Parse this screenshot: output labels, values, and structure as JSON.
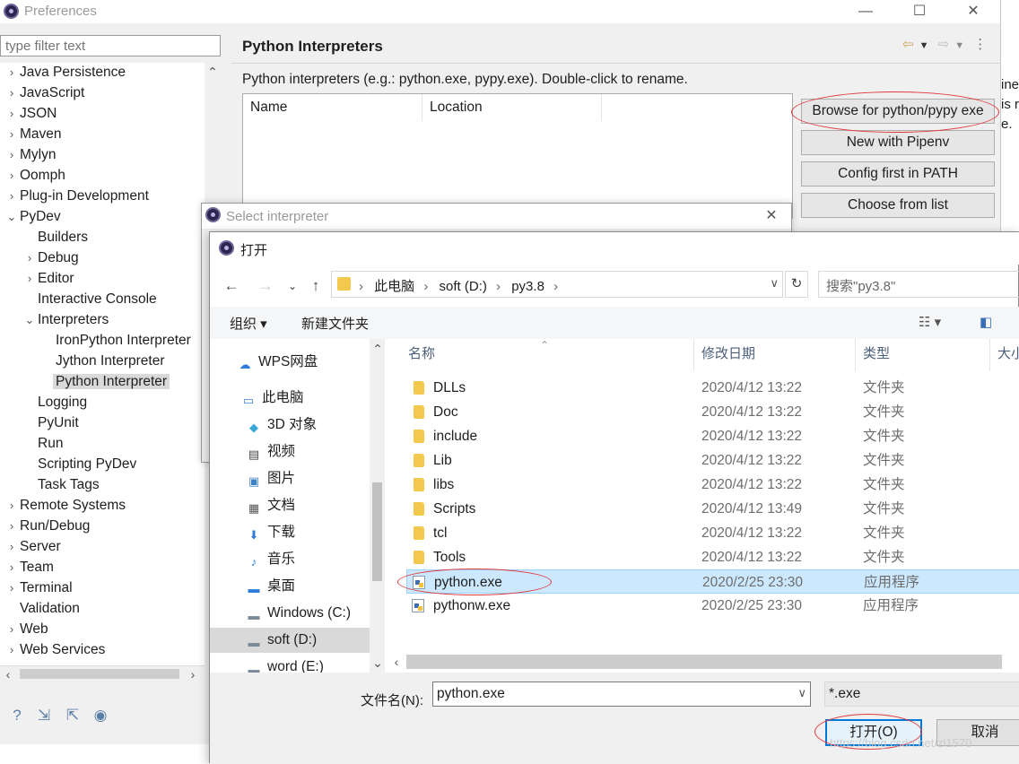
{
  "preferences": {
    "title": "Preferences",
    "filter_placeholder": "type filter text",
    "tree": [
      {
        "label": "Java Persistence",
        "expanded": false
      },
      {
        "label": "JavaScript",
        "expanded": false
      },
      {
        "label": "JSON",
        "expanded": false
      },
      {
        "label": "Maven",
        "expanded": false
      },
      {
        "label": "Mylyn",
        "expanded": false
      },
      {
        "label": "Oomph",
        "expanded": false
      },
      {
        "label": "Plug-in Development",
        "expanded": false
      },
      {
        "label": "PyDev",
        "expanded": true
      },
      {
        "label": "Builders"
      },
      {
        "label": "Debug",
        "expanded": false
      },
      {
        "label": "Editor",
        "expanded": false
      },
      {
        "label": "Interactive Console"
      },
      {
        "label": "Interpreters",
        "expanded": true
      },
      {
        "label": "IronPython Interpreter"
      },
      {
        "label": "Jython Interpreter"
      },
      {
        "label": "Python Interpreter",
        "selected": true
      },
      {
        "label": "Logging"
      },
      {
        "label": "PyUnit"
      },
      {
        "label": "Run"
      },
      {
        "label": "Scripting PyDev"
      },
      {
        "label": "Task Tags"
      },
      {
        "label": "Remote Systems",
        "expanded": false
      },
      {
        "label": "Run/Debug",
        "expanded": false
      },
      {
        "label": "Server",
        "expanded": false
      },
      {
        "label": "Team",
        "expanded": false
      },
      {
        "label": "Terminal",
        "expanded": false
      },
      {
        "label": "Validation"
      },
      {
        "label": "Web",
        "expanded": false
      },
      {
        "label": "Web Services",
        "expanded": false
      }
    ],
    "page_title": "Python Interpreters",
    "description": "Python interpreters (e.g.: python.exe, pypy.exe).   Double-click to rename.",
    "table_headers": [
      "Name",
      "Location"
    ],
    "buttons": {
      "browse": "Browse for python/pypy exe",
      "pipenv": "New with Pipenv",
      "config_path": "Config first in PATH",
      "choose_list": "Choose from list"
    },
    "bg_text": "ine\nis r\ne."
  },
  "select_interpreter": {
    "title": "Select interpreter"
  },
  "open_dialog": {
    "title": "打开",
    "path": [
      "此电脑",
      "soft (D:)",
      "py3.8"
    ],
    "search_placeholder": "搜索\"py3.8\"",
    "toolbar": {
      "organize": "组织 ▾",
      "new_folder": "新建文件夹"
    },
    "nav": [
      {
        "label": "WPS网盘",
        "icon": "cloud-icon"
      },
      {
        "label": "此电脑",
        "icon": "computer-icon"
      },
      {
        "label": "3D 对象",
        "icon": "cube-icon"
      },
      {
        "label": "视频",
        "icon": "video-icon"
      },
      {
        "label": "图片",
        "icon": "picture-icon"
      },
      {
        "label": "文档",
        "icon": "document-icon"
      },
      {
        "label": "下载",
        "icon": "download-icon"
      },
      {
        "label": "音乐",
        "icon": "music-icon"
      },
      {
        "label": "桌面",
        "icon": "desktop-icon"
      },
      {
        "label": "Windows  (C:)",
        "icon": "drive-icon"
      },
      {
        "label": "soft (D:)",
        "icon": "drive-icon",
        "selected": true
      },
      {
        "label": "word (E:)",
        "icon": "drive-icon"
      }
    ],
    "columns": [
      "名称",
      "修改日期",
      "类型",
      "大小"
    ],
    "files": [
      {
        "name": "DLLs",
        "date": "2020/4/12 13:22",
        "type": "文件夹",
        "kind": "folder"
      },
      {
        "name": "Doc",
        "date": "2020/4/12 13:22",
        "type": "文件夹",
        "kind": "folder"
      },
      {
        "name": "include",
        "date": "2020/4/12 13:22",
        "type": "文件夹",
        "kind": "folder"
      },
      {
        "name": "Lib",
        "date": "2020/4/12 13:22",
        "type": "文件夹",
        "kind": "folder"
      },
      {
        "name": "libs",
        "date": "2020/4/12 13:22",
        "type": "文件夹",
        "kind": "folder"
      },
      {
        "name": "Scripts",
        "date": "2020/4/12 13:49",
        "type": "文件夹",
        "kind": "folder"
      },
      {
        "name": "tcl",
        "date": "2020/4/12 13:22",
        "type": "文件夹",
        "kind": "folder"
      },
      {
        "name": "Tools",
        "date": "2020/4/12 13:22",
        "type": "文件夹",
        "kind": "folder"
      },
      {
        "name": "python.exe",
        "date": "2020/2/25 23:30",
        "type": "应用程序",
        "kind": "exe",
        "selected": true
      },
      {
        "name": "pythonw.exe",
        "date": "2020/2/25 23:30",
        "type": "应用程序",
        "kind": "exe"
      }
    ],
    "filename_label": "文件名(N):",
    "filename_value": "python.exe",
    "filetype_value": "*.exe",
    "open_button": "打开(O)",
    "cancel_button": "取消"
  },
  "watermark": "https://blog.csdn.net/zl1570",
  "colors": {
    "annotation": "#e0383c",
    "selection": "#cce8ff",
    "accent": "#0078d7"
  }
}
